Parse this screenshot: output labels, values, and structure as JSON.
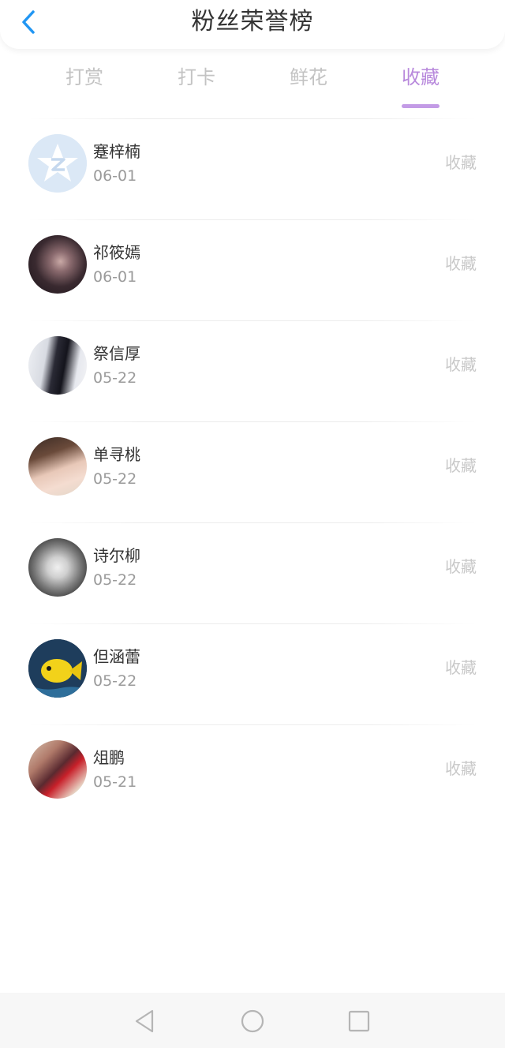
{
  "header": {
    "title": "粉丝荣誉榜",
    "back_icon": "chevron-left-icon"
  },
  "tabs": [
    {
      "label": "打赏",
      "active": false
    },
    {
      "label": "打卡",
      "active": false
    },
    {
      "label": "鲜花",
      "active": false
    },
    {
      "label": "收藏",
      "active": true
    }
  ],
  "list": [
    {
      "name": "蹇梓楠",
      "date": "06-01",
      "action": "收藏"
    },
    {
      "name": "祁筱嫣",
      "date": "06-01",
      "action": "收藏"
    },
    {
      "name": "祭信厚",
      "date": "05-22",
      "action": "收藏"
    },
    {
      "name": "单寻桃",
      "date": "05-22",
      "action": "收藏"
    },
    {
      "name": "诗尔柳",
      "date": "05-22",
      "action": "收藏"
    },
    {
      "name": "但涵蕾",
      "date": "05-22",
      "action": "收藏"
    },
    {
      "name": "俎鹏",
      "date": "05-21",
      "action": "收藏"
    }
  ],
  "navbar": {
    "back_icon": "triangle-back-icon",
    "home_icon": "circle-home-icon",
    "recents_icon": "square-recents-icon"
  },
  "colors": {
    "accent": "#b889dc",
    "back_arrow": "#2196f3",
    "inactive_tab": "#c3c3c3"
  }
}
